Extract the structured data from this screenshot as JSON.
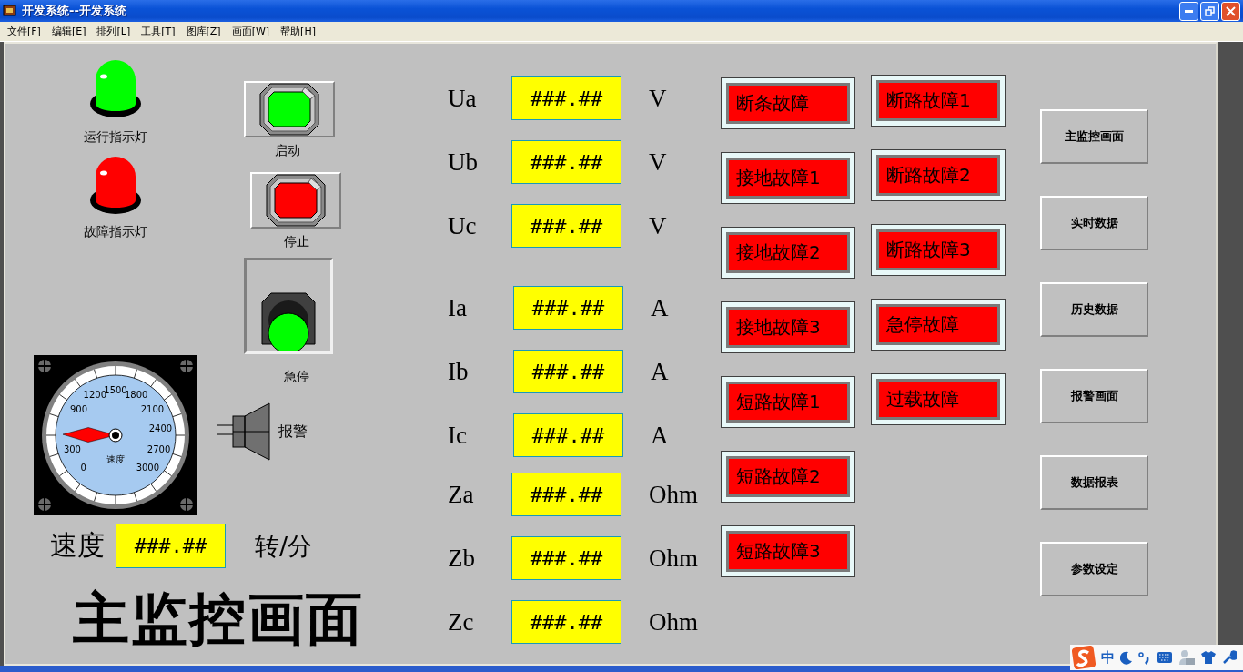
{
  "window": {
    "title": "开发系统--开发系统"
  },
  "menu": [
    "文件[F]",
    "编辑[E]",
    "排列[L]",
    "工具[T]",
    "图库[Z]",
    "画面[W]",
    "帮助[H]"
  ],
  "indicator_lights": [
    {
      "label": "运行指示灯",
      "color": "#00ff00"
    },
    {
      "label": "故障指示灯",
      "color": "#ff0000"
    }
  ],
  "push_buttons": [
    {
      "label": "启动",
      "color": "#00ff00"
    },
    {
      "label": "停止",
      "color": "#ff0000"
    }
  ],
  "emergency_stop": {
    "label": "急停"
  },
  "alarm": {
    "label": "报警"
  },
  "gauge": {
    "label": "速度",
    "ticks": [
      "0",
      "300",
      "900",
      "1200",
      "1500",
      "1800",
      "2100",
      "2400",
      "2700",
      "3000"
    ],
    "level": 0.17
  },
  "speed": {
    "label": "速度",
    "value": "###.##",
    "unit": "转/分"
  },
  "title": "主监控画面",
  "measurement_groups": [
    [
      {
        "label": "Ua",
        "value": "###.##",
        "unit": "V"
      },
      {
        "label": "Ub",
        "value": "###.##",
        "unit": "V"
      },
      {
        "label": "Uc",
        "value": "###.##",
        "unit": "V"
      }
    ],
    [
      {
        "label": "Ia",
        "value": "###.##",
        "unit": "A"
      },
      {
        "label": "Ib",
        "value": "###.##",
        "unit": "A"
      },
      {
        "label": "Ic",
        "value": "###.##",
        "unit": "A"
      }
    ],
    [
      {
        "label": "Za",
        "value": "###.##",
        "unit": "Ohm"
      },
      {
        "label": "Zb",
        "value": "###.##",
        "unit": "Ohm"
      },
      {
        "label": "Zc",
        "value": "###.##",
        "unit": "Ohm"
      }
    ]
  ],
  "fault_columns": [
    [
      "断条故障",
      "接地故障1",
      "接地故障2",
      "接地故障3",
      "短路故障1",
      "短路故障2",
      "短路故障3"
    ],
    [
      "断路故障1",
      "断路故障2",
      "断路故障3",
      "急停故障",
      "过载故障"
    ]
  ],
  "nav_buttons": [
    "主监控画面",
    "实时数据",
    "历史数据",
    "报警画面",
    "数据报表",
    "参数设定"
  ],
  "ime_bar": {
    "mode": "中"
  }
}
